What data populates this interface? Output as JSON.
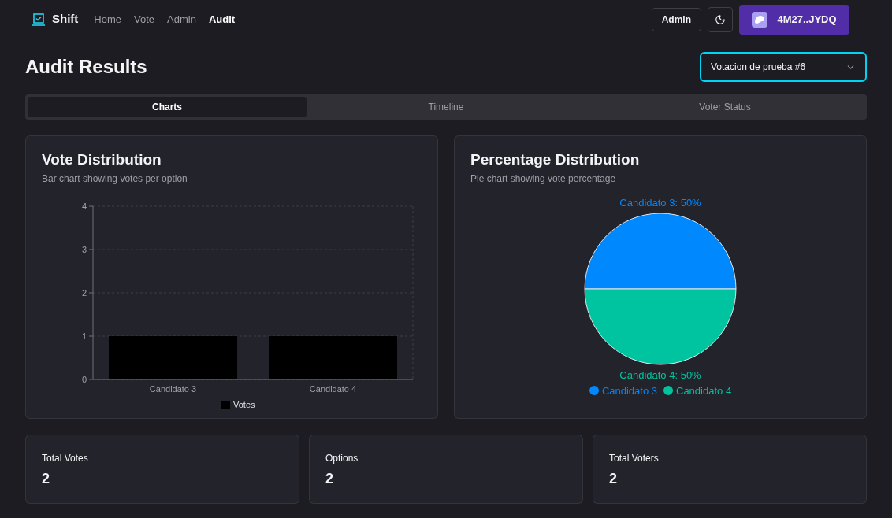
{
  "nav": {
    "brand": "Shift",
    "links": [
      {
        "label": "Home",
        "selected": false
      },
      {
        "label": "Vote",
        "selected": false
      },
      {
        "label": "Admin",
        "selected": false
      },
      {
        "label": "Audit",
        "selected": true
      }
    ],
    "admin_button": "Admin",
    "wallet": "4M27..JYDQ"
  },
  "title": "Audit Results",
  "select": {
    "value": "Votacion de prueba #6"
  },
  "tabs": [
    {
      "label": "Charts",
      "selected": true
    },
    {
      "label": "Timeline",
      "selected": false
    },
    {
      "label": "Voter Status",
      "selected": false
    }
  ],
  "vote_distribution": {
    "title": "Vote Distribution",
    "subtitle": "Bar chart showing votes per option",
    "chart_data": {
      "type": "bar",
      "categories": [
        "Candidato 3",
        "Candidato 4"
      ],
      "series": [
        {
          "name": "Votes",
          "color": "#000000",
          "values": [
            1,
            1
          ]
        }
      ],
      "ylim": [
        0,
        4
      ],
      "yticks": [
        0,
        1,
        2,
        3,
        4
      ],
      "grid": true,
      "legend": "bottom"
    }
  },
  "percentage_distribution": {
    "title": "Percentage Distribution",
    "subtitle": "Pie chart showing vote percentage",
    "chart_data": {
      "type": "pie",
      "categories": [
        "Candidato 3",
        "Candidato 4"
      ],
      "values": [
        50,
        50
      ],
      "legend": "bottom",
      "colors": [
        "#0088fe",
        "#00c49f"
      ],
      "value_labels": [
        "Candidato 3: 50%",
        "Candidato 4: 50%"
      ]
    }
  },
  "stats": [
    {
      "label": "Total Votes",
      "value": "2"
    },
    {
      "label": "Options",
      "value": "2"
    },
    {
      "label": "Total Voters",
      "value": "2"
    }
  ]
}
